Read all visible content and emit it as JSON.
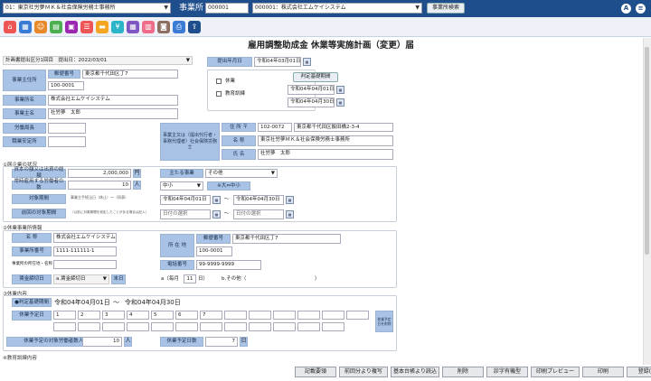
{
  "topbar": {
    "office_select": "01：東京社労夢ＭＫ＆社会保険労務士事務所",
    "office_label": "事業所",
    "office_code": "000001",
    "office_name": "000001：株式会社エムケイシステム",
    "search_button": "事業所検索",
    "help_icon": "A",
    "menu_icon": "≡"
  },
  "form_title": "雇用調整助成金 休業等実施計画（変更）届",
  "plan_select": "計画書提出区分1回目　提出日：2022/03/01",
  "employer": {
    "addr_label": "事業主住所",
    "postal_label": "郵便番号",
    "postal_value": "東京都千代田区丁7",
    "zip": "100-0001",
    "name_label": "事業所名",
    "name_value": "株式会社エムケイシステム",
    "owner_label": "事業主名",
    "owner_value": "社労夢　太郎",
    "labor_label": "労働局長",
    "office_label": "職業安定所"
  },
  "submission": {
    "date_label": "提出年月日",
    "date_value": "令和04年03月01日",
    "check_leave": "休業",
    "check_training": "教育訓練",
    "period_button": "判定基礎期間",
    "period_from": "令和04年04月01日",
    "period_to": "令和04年04月30日"
  },
  "agent": {
    "label": "事業主又は（提出代行者・事務代理者）社会保険労務士",
    "addr_label": "住 所 〒",
    "zip": "102-0072",
    "addr": "東京都千代田区飯田橋2-3-4",
    "name_label": "名 称",
    "name": "東京社労夢ＭＫ＆社会保険労務士事務所",
    "person_label": "氏 名",
    "person": "社労夢　太郎"
  },
  "section1": {
    "title": "①届企業の状況",
    "capital_label": "資本の額又は出資の総額",
    "capital": "2,000,000",
    "yen": "円",
    "employees_label": "常時雇用する労働者の数",
    "employees": "10",
    "people": "人",
    "industry_label": "主たる事業",
    "industry": "その他",
    "size_select": "中小",
    "size_button": "※大⇔中小",
    "target_label": "対象期間",
    "target_note": "事業主手続当日（休止）～（同表）",
    "target_from": "令和04年04月01日",
    "target_to": "令和04年04月30日",
    "tilde": "～",
    "prev_label": "前回の対象期間",
    "prev_note": "（以前に対象期間を設定したことがある場合は記入）",
    "prev_from": "日付の選択",
    "prev_to": "日付の選択"
  },
  "section2": {
    "title": "②休業事業所情報",
    "name_label": "名 称",
    "name": "株式会社エムケイシステム",
    "ins_label": "事業所番号",
    "ins": "1111-111111-1",
    "owner_label": "事業所の所在地・名称",
    "loc_label": "所 在 地",
    "postal_label": "郵便番号",
    "postal": "東京都千代田区丁7",
    "zip": "100-0001",
    "tel_label": "電話番号",
    "tel": "99-9999-9999",
    "wage_label": "賃金締切日",
    "wage_select": "a.賃金締切日",
    "wage_end": "末日",
    "a_label": "a（毎月",
    "a_value": "11",
    "a_unit": "日）",
    "b_label": "b.その他（",
    "b_close": "）"
  },
  "section3": {
    "title": "③休業内容",
    "radio_label": "判定基礎期間",
    "period_from": "令和04年04月01日",
    "tilde": "～",
    "period_to": "令和04年04月30日",
    "schedule_label": "休業予定日",
    "days": [
      "1",
      "2",
      "3",
      "4",
      "5",
      "6",
      "7",
      "",
      "",
      "",
      "",
      "",
      "",
      "",
      "",
      "",
      "",
      "",
      "",
      "",
      "",
      "",
      "",
      "",
      ""
    ],
    "clear_button": "休業予定日を削除",
    "people_label": "休業予定の対象労働者数人員",
    "people": "10",
    "people_unit": "人",
    "days_label": "休業予定日数",
    "days_value": "7",
    "days_unit": "日"
  },
  "section4": {
    "title": "④教育訓練内容"
  },
  "footer": {
    "buttons": [
      "記載要領",
      "前回分より複写",
      "基本台帳より読込",
      "削除",
      "診字有機型",
      "印刷プレビュー",
      "印刷",
      "登録(S)"
    ]
  }
}
